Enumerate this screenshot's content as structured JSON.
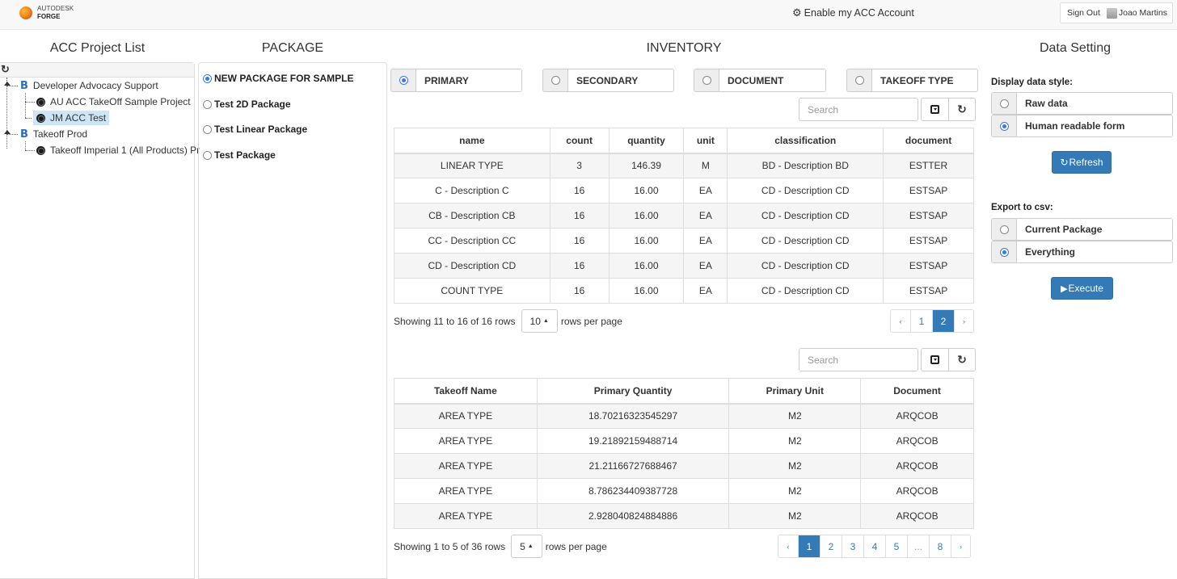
{
  "navbar": {
    "logo_line1": "AUTODESK",
    "logo_line2": "FORGE",
    "enable_acc_icon": "gear-icon",
    "enable_acc_label": "Enable my ACC Account",
    "sign_out_label": "Sign Out",
    "user_name": "Joao Martins"
  },
  "project_list": {
    "title": "ACC Project List",
    "refresh_icon": "↻",
    "nodes": [
      {
        "label": "Developer Advocacy Support",
        "type": "hub",
        "icon": "B",
        "expanded": true
      },
      {
        "label": "AU ACC TakeOff Sample Project",
        "type": "project"
      },
      {
        "label": "JM ACC Test",
        "type": "project",
        "selected": true
      },
      {
        "label": "Takeoff Prod",
        "type": "hub",
        "icon": "B",
        "expanded": true
      },
      {
        "label": "Takeoff Imperial 1 (All Products) Pr",
        "type": "project"
      }
    ]
  },
  "package": {
    "title": "PACKAGE",
    "items": [
      {
        "label": "NEW PACKAGE FOR SAMPLE",
        "checked": true
      },
      {
        "label": "Test 2D Package",
        "checked": false
      },
      {
        "label": "Test Linear Package",
        "checked": false
      },
      {
        "label": "Test Package",
        "checked": false
      }
    ]
  },
  "inventory": {
    "title": "INVENTORY",
    "groups": [
      {
        "label": "PRIMARY",
        "checked": true
      },
      {
        "label": "SECONDARY",
        "checked": false
      },
      {
        "label": "DOCUMENT",
        "checked": false
      },
      {
        "label": "TAKEOFF TYPE",
        "checked": false
      }
    ],
    "table1": {
      "search_placeholder": "Search",
      "columns": [
        "name",
        "count",
        "quantity",
        "unit",
        "classification",
        "document"
      ],
      "rows": [
        [
          "LINEAR TYPE",
          "3",
          "146.39",
          "M",
          "BD - Description BD",
          "ESTTER"
        ],
        [
          "C - Description C",
          "16",
          "16.00",
          "EA",
          "CD - Description CD",
          "ESTSAP"
        ],
        [
          "CB - Description CB",
          "16",
          "16.00",
          "EA",
          "CD - Description CD",
          "ESTSAP"
        ],
        [
          "CC - Description CC",
          "16",
          "16.00",
          "EA",
          "CD - Description CD",
          "ESTSAP"
        ],
        [
          "CD - Description CD",
          "16",
          "16.00",
          "EA",
          "CD - Description CD",
          "ESTSAP"
        ],
        [
          "COUNT TYPE",
          "16",
          "16.00",
          "EA",
          "CD - Description CD",
          "ESTSAP"
        ]
      ],
      "showing_text": "Showing 11 to 16 of 16 rows",
      "page_size": "10",
      "rows_per_page_text": "rows per page",
      "pages": [
        "‹",
        "1",
        "2",
        "›"
      ],
      "active_page": "2"
    },
    "table2": {
      "search_placeholder": "Search",
      "columns": [
        "Takeoff Name",
        "Primary Quantity",
        "Primary Unit",
        "Document"
      ],
      "rows": [
        [
          "AREA TYPE",
          "18.70216323545297",
          "M2",
          "ARQCOB"
        ],
        [
          "AREA TYPE",
          "19.21892159488714",
          "M2",
          "ARQCOB"
        ],
        [
          "AREA TYPE",
          "21.21166727688467",
          "M2",
          "ARQCOB"
        ],
        [
          "AREA TYPE",
          "8.786234409387728",
          "M2",
          "ARQCOB"
        ],
        [
          "AREA TYPE",
          "2.928040824884886",
          "M2",
          "ARQCOB"
        ]
      ],
      "showing_text": "Showing 1 to 5 of 36 rows",
      "page_size": "5",
      "rows_per_page_text": "rows per page",
      "pages": [
        "‹",
        "1",
        "2",
        "3",
        "4",
        "5",
        "...",
        "8",
        "›"
      ],
      "active_page": "1"
    }
  },
  "data_setting": {
    "title": "Data Setting",
    "display_label": "Display data style:",
    "display_options": [
      {
        "label": "Raw data",
        "checked": false
      },
      {
        "label": "Human readable form",
        "checked": true
      }
    ],
    "refresh_label": "Refresh",
    "export_label": "Export to csv:",
    "export_options": [
      {
        "label": "Current Package",
        "checked": false
      },
      {
        "label": "Everything",
        "checked": true
      }
    ],
    "execute_label": "Execute"
  },
  "colors": {
    "primary": "#337ab7",
    "radio_checked": "#3478f6",
    "selected_node": "#cce6f7",
    "hub_icon": "#2a6ebb"
  }
}
